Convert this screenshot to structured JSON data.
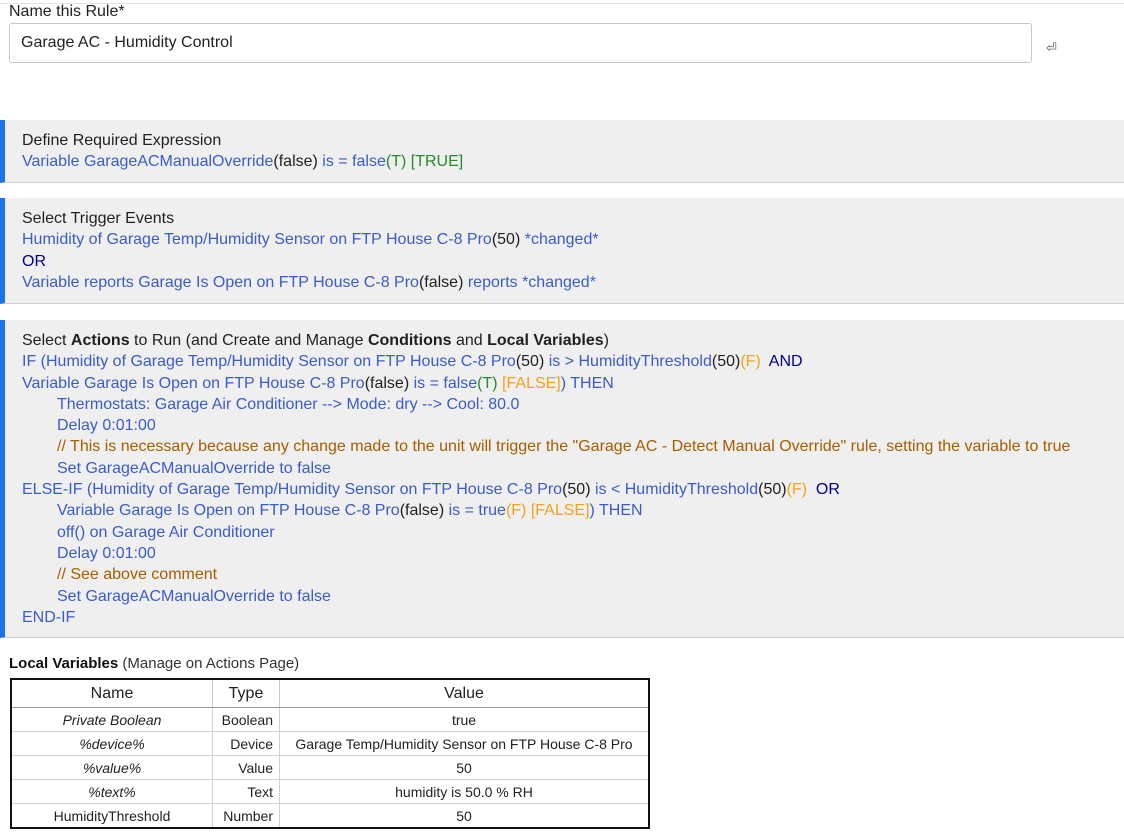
{
  "name_rule": {
    "label": "Name this Rule*",
    "value": "Garage AC - Humidity Control",
    "enter_icon": "⏎"
  },
  "required_expression": {
    "title": "Define Required Expression",
    "l1": {
      "a": "Variable GarageACManualOverride",
      "b": "(false)",
      "c": " is = false",
      "d": "(T)",
      "e": " [TRUE]"
    }
  },
  "trigger_events": {
    "title": "Select Trigger Events",
    "l1": {
      "a": "Humidity of Garage Temp/Humidity Sensor on FTP House C-8 Pro",
      "b": "(50)",
      "c": " *changed*"
    },
    "l2": {
      "a": "OR"
    },
    "l3": {
      "a": "Variable reports Garage Is Open on FTP House C-8 Pro",
      "b": "(false)",
      "c": " reports *changed*"
    }
  },
  "actions": {
    "title": {
      "t1": "Select ",
      "t2": "Actions",
      "t3": " to Run (and Create and Manage ",
      "t4": "Conditions",
      "t5": " and ",
      "t6": "Local Variables",
      "t7": ")"
    },
    "l1": {
      "a": "IF (Humidity of Garage Temp/Humidity Sensor on FTP House C-8 Pro",
      "b": "(50)",
      "c": " is > HumidityThreshold",
      "d": "(50)",
      "e": "(F)",
      "f": "  AND"
    },
    "l2": {
      "a": "Variable Garage Is Open on FTP House C-8 Pro",
      "b": "(false)",
      "c": " is = false",
      "d": "(T)",
      "e": " [FALSE]",
      "f": ") THEN"
    },
    "l3": {
      "a": "Thermostats: Garage Air Conditioner --> Mode: dry --> Cool: 80.0"
    },
    "l4": {
      "a": "Delay 0:01:00"
    },
    "l5": {
      "a": "// This is necessary because any change made to the unit will trigger the \"Garage AC - Detect Manual Override\" rule, setting the variable to true"
    },
    "l6": {
      "a": "Set GarageACManualOverride to false"
    },
    "l7": {
      "a": "ELSE-IF (Humidity of Garage Temp/Humidity Sensor on FTP House C-8 Pro",
      "b": "(50)",
      "c": " is < HumidityThreshold",
      "d": "(50)",
      "e": "(F)",
      "f": "  OR"
    },
    "l8": {
      "a": "Variable Garage Is Open on FTP House C-8 Pro",
      "b": "(false)",
      "c": " is = true",
      "d": "(F)",
      "e": " [FALSE]",
      "f": ") THEN"
    },
    "l9": {
      "a": "off() on Garage Air Conditioner"
    },
    "l10": {
      "a": "Delay 0:01:00"
    },
    "l11": {
      "a": "// See above comment"
    },
    "l12": {
      "a": "Set GarageACManualOverride to false"
    },
    "l13": {
      "a": "END-IF"
    }
  },
  "local_variables": {
    "title": "Local Variables",
    "subtitle": " (Manage on Actions Page)",
    "headers": {
      "name": "Name",
      "type": "Type",
      "value": "Value"
    },
    "rows": [
      {
        "name": "Private Boolean",
        "type": "Boolean",
        "value": "true"
      },
      {
        "name": "%device%",
        "type": "Device",
        "value": "Garage Temp/Humidity Sensor on FTP House C-8 Pro"
      },
      {
        "name": "%value%",
        "type": "Value",
        "value": "50"
      },
      {
        "name": "%text%",
        "type": "Text",
        "value": "humidity is 50.0 % RH"
      },
      {
        "name": "HumidityThreshold",
        "type": "Number",
        "value": "50"
      }
    ]
  },
  "colors": {
    "accent": "#1a73e8",
    "link_blue": "#3b5cc6",
    "true_green": "#28882e",
    "false_orange": "#f4a21b",
    "comment_brown": "#a55d00",
    "operator_navy": "#00008b"
  }
}
